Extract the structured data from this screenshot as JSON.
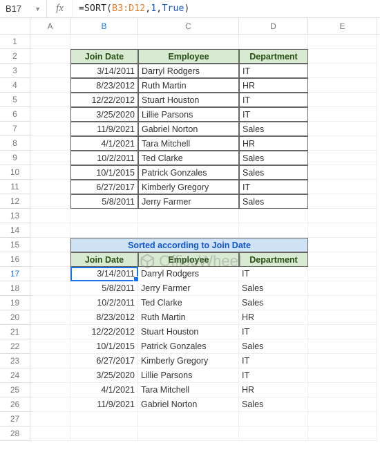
{
  "active_cell": "B17",
  "formula": {
    "raw": "=SORT(B3:D12,1,True)",
    "eq": "=",
    "fn": "SORT",
    "open": "(",
    "range": "B3:D12",
    "c1": ",",
    "num": "1",
    "c2": ",",
    "bool": "True",
    "close": ")"
  },
  "columns": [
    "A",
    "B",
    "C",
    "D",
    "E"
  ],
  "rows": [
    "1",
    "2",
    "3",
    "4",
    "5",
    "6",
    "7",
    "8",
    "9",
    "10",
    "11",
    "12",
    "13",
    "14",
    "15",
    "16",
    "17",
    "18",
    "19",
    "20",
    "21",
    "22",
    "23",
    "24",
    "25",
    "26",
    "27",
    "28"
  ],
  "table1": {
    "headers": {
      "date": "Join Date",
      "emp": "Employee",
      "dept": "Department"
    },
    "rows": [
      {
        "date": "3/14/2011",
        "emp": "Darryl Rodgers",
        "dept": "IT"
      },
      {
        "date": "8/23/2012",
        "emp": "Ruth Martin",
        "dept": "HR"
      },
      {
        "date": "12/22/2012",
        "emp": "Stuart Houston",
        "dept": "IT"
      },
      {
        "date": "3/25/2020",
        "emp": "Lillie Parsons",
        "dept": "IT"
      },
      {
        "date": "11/9/2021",
        "emp": "Gabriel Norton",
        "dept": "Sales"
      },
      {
        "date": "4/1/2021",
        "emp": "Tara Mitchell",
        "dept": "HR"
      },
      {
        "date": "10/2/2011",
        "emp": "Ted Clarke",
        "dept": "Sales"
      },
      {
        "date": "10/1/2015",
        "emp": "Patrick Gonzales",
        "dept": "Sales"
      },
      {
        "date": "6/27/2017",
        "emp": "Kimberly Gregory",
        "dept": "IT"
      },
      {
        "date": "5/8/2011",
        "emp": "Jerry Farmer",
        "dept": "Sales"
      }
    ]
  },
  "table2": {
    "title": "Sorted according to Join Date",
    "headers": {
      "date": "Join Date",
      "emp": "Employee",
      "dept": "Department"
    },
    "rows": [
      {
        "date": "3/14/2011",
        "emp": "Darryl Rodgers",
        "dept": "IT"
      },
      {
        "date": "5/8/2011",
        "emp": "Jerry Farmer",
        "dept": "Sales"
      },
      {
        "date": "10/2/2011",
        "emp": "Ted Clarke",
        "dept": "Sales"
      },
      {
        "date": "8/23/2012",
        "emp": "Ruth Martin",
        "dept": "HR"
      },
      {
        "date": "12/22/2012",
        "emp": "Stuart Houston",
        "dept": "IT"
      },
      {
        "date": "10/1/2015",
        "emp": "Patrick Gonzales",
        "dept": "Sales"
      },
      {
        "date": "6/27/2017",
        "emp": "Kimberly Gregory",
        "dept": "IT"
      },
      {
        "date": "3/25/2020",
        "emp": "Lillie Parsons",
        "dept": "IT"
      },
      {
        "date": "4/1/2021",
        "emp": "Tara Mitchell",
        "dept": "HR"
      },
      {
        "date": "11/9/2021",
        "emp": "Gabriel Norton",
        "dept": "Sales"
      }
    ]
  },
  "watermark": "OfficeWheel"
}
